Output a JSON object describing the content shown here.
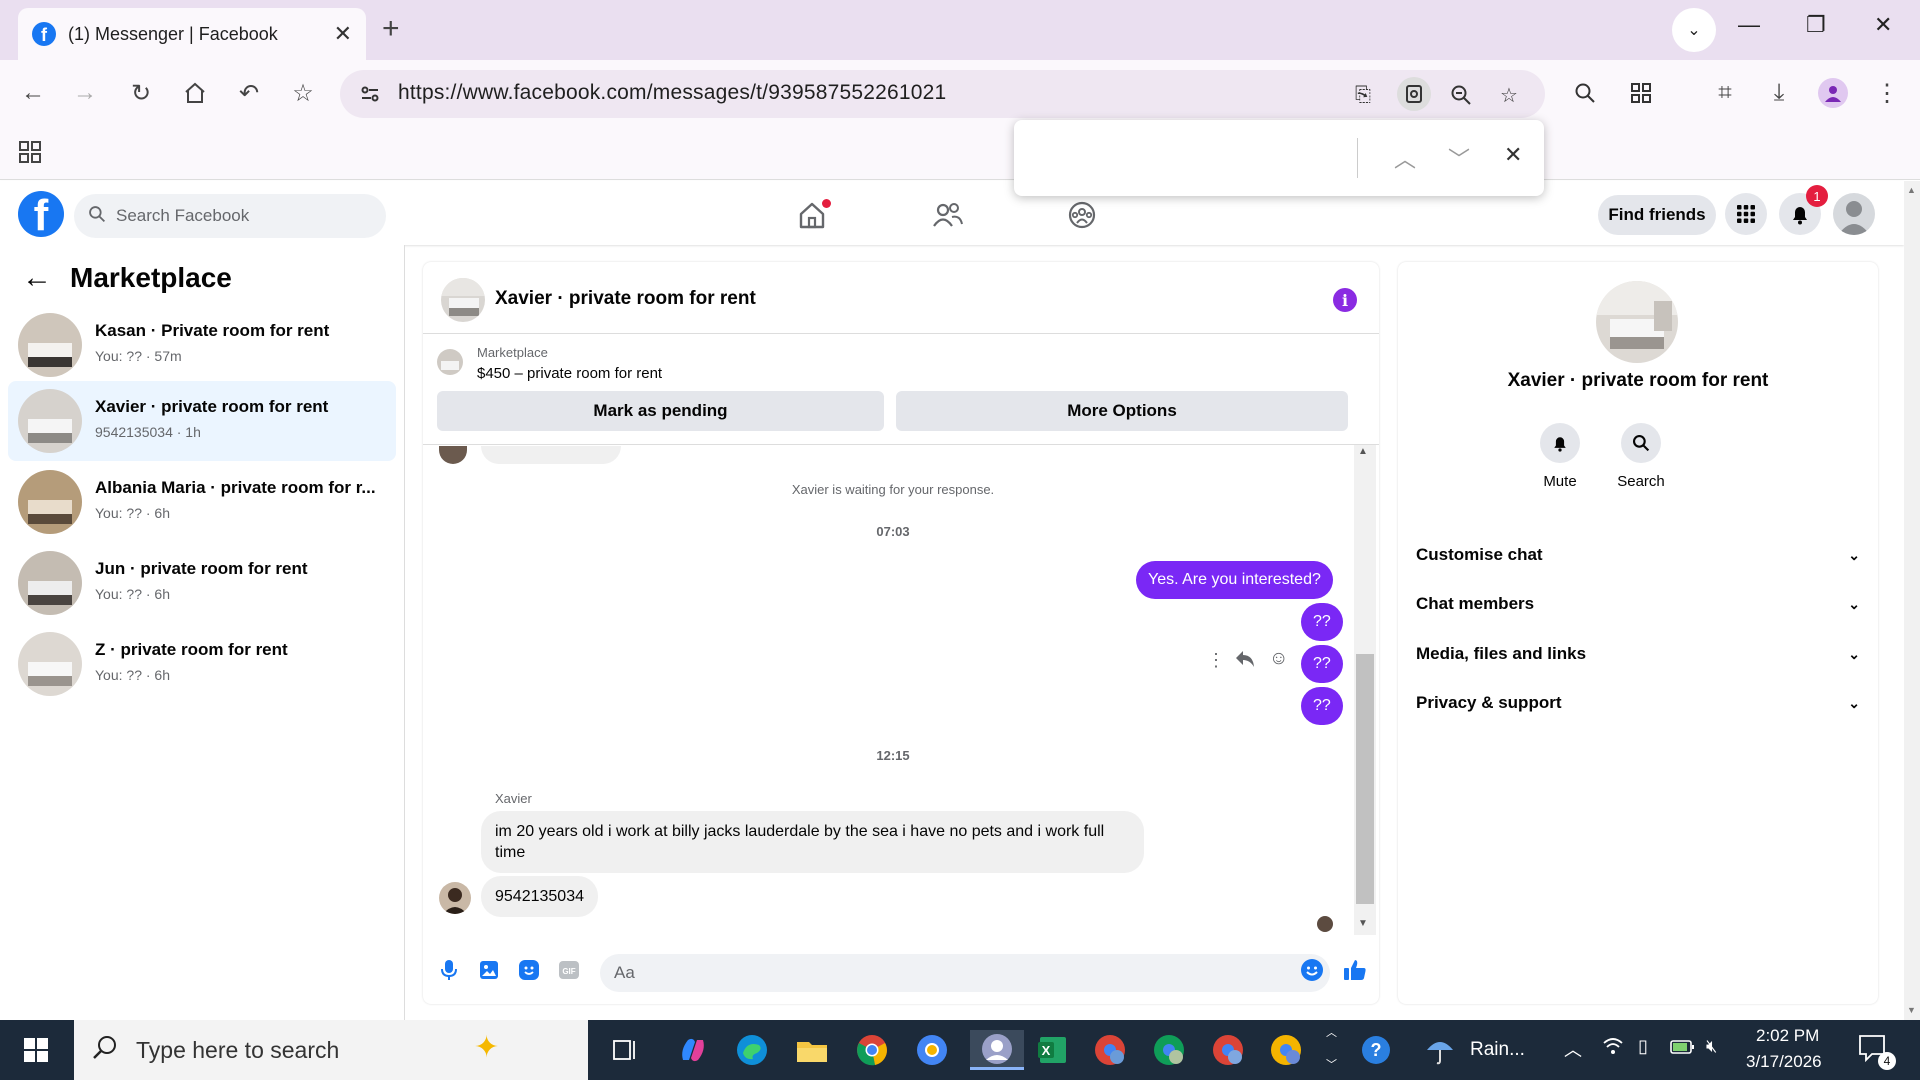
{
  "browser": {
    "tab_title": "(1) Messenger | Facebook",
    "url": "https://www.facebook.com/messages/t/939587552261021"
  },
  "facebook": {
    "search_placeholder": "Search Facebook",
    "find_friends_label": "Find friends",
    "notification_count": "1"
  },
  "left_panel": {
    "title": "Marketplace",
    "conversations": [
      {
        "name": "Kasan · Private room for rent",
        "sub": "You: ?? · 57m",
        "active": false
      },
      {
        "name": "Xavier · private room for rent",
        "sub": "9542135034 · 1h",
        "active": true
      },
      {
        "name": "Albania Maria · private room for r...",
        "sub": "You: ?? · 6h",
        "active": false
      },
      {
        "name": "Jun · private room for rent",
        "sub": "You: ?? · 6h",
        "active": false
      },
      {
        "name": "Z · private room for rent",
        "sub": "You: ?? · 6h",
        "active": false
      }
    ]
  },
  "chat": {
    "title": "Xavier · private room for rent",
    "marketplace_label": "Marketplace",
    "listing": "$450 – private room for rent",
    "mark_pending_label": "Mark as pending",
    "more_options_label": "More Options",
    "waiting_text": "Xavier is waiting for your response.",
    "time1": "07:03",
    "out_messages": [
      "Yes. Are you interested?",
      "??",
      "??",
      "??"
    ],
    "time2": "12:15",
    "sender_name": "Xavier",
    "in_message_1": "im 20 years old i work at billy jacks lauderdale by the sea i have no pets and i work full time",
    "in_message_2": "9542135034",
    "composer_placeholder": "Aa"
  },
  "right_panel": {
    "name": "Xavier · private room for rent",
    "mute_label": "Mute",
    "search_label": "Search",
    "sections": [
      "Customise chat",
      "Chat members",
      "Media, files and links",
      "Privacy & support"
    ]
  },
  "taskbar": {
    "search_placeholder": "Type here to search",
    "weather": "Rain...",
    "time": "2:02 PM",
    "date": "3/17/2026",
    "notification_count": "4"
  },
  "colors": {
    "facebook_blue": "#1877f2",
    "messenger_purple": "#7a28f5",
    "notification_red": "#e41e3f"
  }
}
